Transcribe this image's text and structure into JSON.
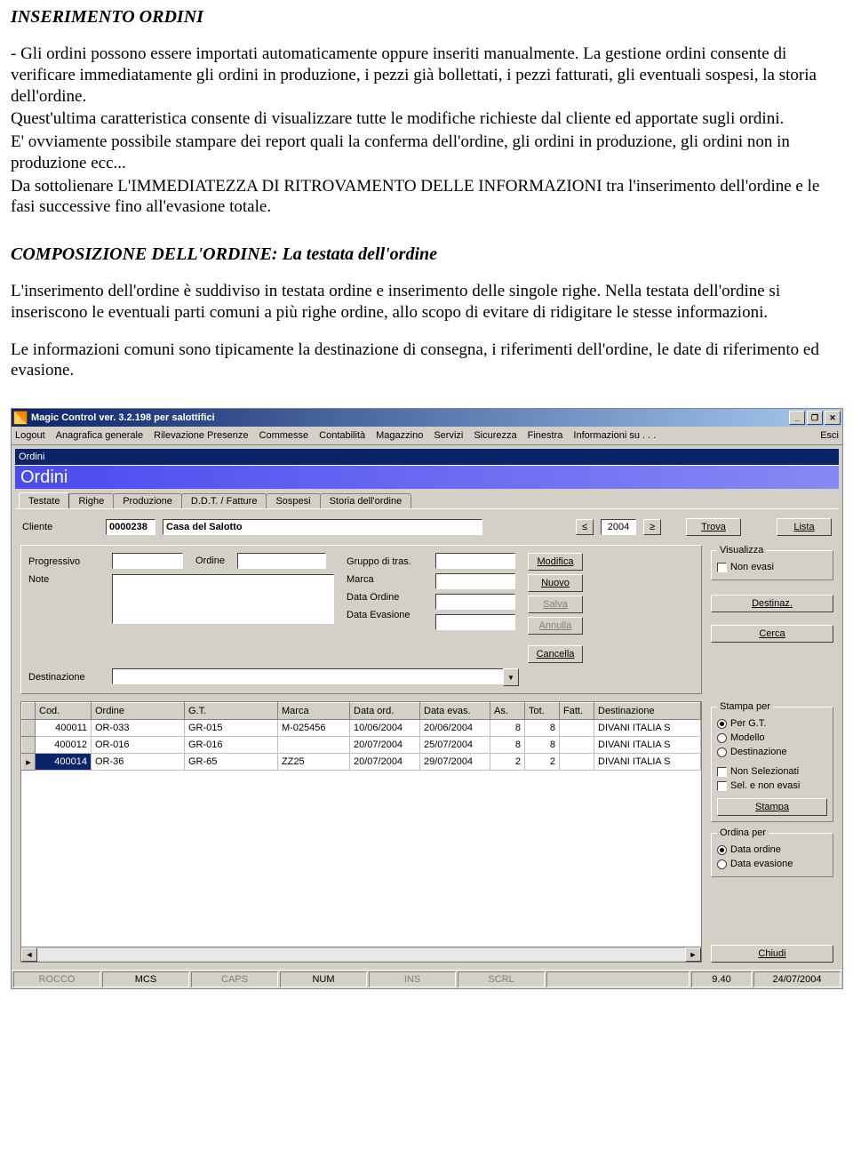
{
  "doc": {
    "title": "INSERIMENTO ORDINI",
    "p1": "- Gli ordini possono essere importati automaticamente oppure inseriti manualmente. La gestione ordini consente di verificare immediatamente gli ordini in produzione, i pezzi già bollettati, i pezzi fatturati, gli eventuali sospesi, la storia dell'ordine.",
    "p2": "Quest'ultima caratteristica consente di visualizzare tutte le modifiche richieste dal cliente ed apportate sugli ordini.",
    "p3": "E' ovviamente possibile stampare dei report quali la conferma dell'ordine, gli ordini in produzione, gli ordini non in produzione ecc...",
    "p4": "Da sottolienare L'IMMEDIATEZZA DI RITROVAMENTO DELLE INFORMAZIONI tra l'inserimento dell'ordine e le fasi successive fino all'evasione totale.",
    "subtitle": "COMPOSIZIONE DELL'ORDINE: La testata dell'ordine",
    "p5": "L'inserimento dell'ordine è suddiviso in testata ordine e inserimento delle singole righe. Nella testata dell'ordine si inseriscono le eventuali parti comuni a più righe ordine, allo scopo di evitare di ridigitare le stesse informazioni.",
    "p6": "Le informazioni comuni sono tipicamente la destinazione di consegna, i riferimenti dell'ordine, le date di riferimento ed evasione."
  },
  "app": {
    "title": "Magic Control ver. 3.2.198 per salottifici",
    "menu": [
      "Logout",
      "Anagrafica generale",
      "Rilevazione Presenze",
      "Commesse",
      "Contabilità",
      "Magazzino",
      "Servizi",
      "Sicurezza",
      "Finestra",
      "Informazioni su . . .",
      "Esci"
    ],
    "childTitle": "Ordini",
    "banner": "Ordini",
    "tabs": [
      "Testate",
      "Righe",
      "Produzione",
      "D.D.T. / Fatture",
      "Sospesi",
      "Storia dell'ordine"
    ],
    "activeTab": 0,
    "clienteLabel": "Cliente",
    "clienteCode": "0000238",
    "clienteName": "Casa del Salotto",
    "year": "2004",
    "prevBtn": "≤",
    "nextBtn": "≥",
    "trova": "Trova",
    "lista": "Lista",
    "visualizzaTitle": "Visualizza",
    "nonEvasi": "Non evasi",
    "fields": {
      "progressivo": "Progressivo",
      "ordine": "Ordine",
      "gruppoTras": "Gruppo di tras.",
      "marca": "Marca",
      "dataOrdine": "Data Ordine",
      "dataEvasione": "Data Evasione",
      "note": "Note",
      "destinazione": "Destinazione"
    },
    "actions": {
      "modifica": "Modifica",
      "nuovo": "Nuovo",
      "salva": "Salva",
      "annulla": "Annulla",
      "cancella": "Cancella",
      "destinaz": "Destinaz.",
      "cerca": "Cerca"
    },
    "table": {
      "headers": [
        "Cod.",
        "Ordine",
        "G.T.",
        "Marca",
        "Data ord.",
        "Data evas.",
        "As.",
        "Tot.",
        "Fatt.",
        "Destinazione"
      ],
      "rows": [
        {
          "cod": "400011",
          "ordine": "OR-033",
          "gt": "GR-015",
          "marca": "M-025456",
          "dord": "10/06/2004",
          "devas": "20/06/2004",
          "as": "8",
          "tot": "8",
          "fatt": "",
          "dest": "DIVANI ITALIA S"
        },
        {
          "cod": "400012",
          "ordine": "OR-016",
          "gt": "GR-016",
          "marca": "",
          "dord": "20/07/2004",
          "devas": "25/07/2004",
          "as": "8",
          "tot": "8",
          "fatt": "",
          "dest": "DIVANI ITALIA S"
        },
        {
          "cod": "400014",
          "ordine": "OR-36",
          "gt": "GR-65",
          "marca": "ZZ25",
          "dord": "20/07/2004",
          "devas": "29/07/2004",
          "as": "2",
          "tot": "2",
          "fatt": "",
          "dest": "DIVANI ITALIA S"
        }
      ],
      "selectedRow": 2
    },
    "stampaPer": {
      "title": "Stampa per",
      "options": [
        "Per G.T.",
        "Modello",
        "Destinazione"
      ],
      "selected": 0,
      "nonSelezionati": "Non Selezionati",
      "selNonEvasi": "Sel. e non evasi",
      "stampa": "Stampa"
    },
    "ordinaPer": {
      "title": "Ordina per",
      "options": [
        "Data ordine",
        "Data evasione"
      ],
      "selected": 0
    },
    "chiudi": "Chiudi",
    "status": {
      "user": "ROCCO",
      "mcs": "MCS",
      "caps": "CAPS",
      "num": "NUM",
      "ins": "INS",
      "scrl": "SCRL",
      "time": "9.40",
      "date": "24/07/2004"
    }
  }
}
